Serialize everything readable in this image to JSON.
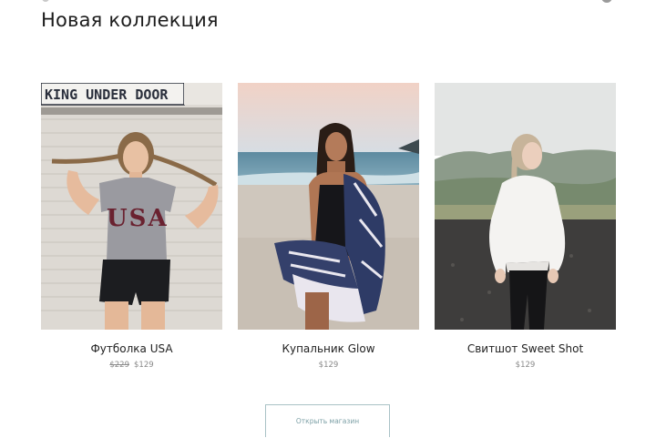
{
  "section": {
    "title": "Новая коллекция"
  },
  "products": [
    {
      "name": "Футболка USA",
      "old_price": "$229",
      "price": "$129",
      "sign_text": "KING UNDER DOOR",
      "shirt_text": "USA"
    },
    {
      "name": "Купальник Glow",
      "old_price": "",
      "price": "$129"
    },
    {
      "name": "Свитшот Sweet Shot",
      "old_price": "",
      "price": "$129"
    }
  ],
  "shop_button": {
    "label": "Открыть магазин"
  },
  "colors": {
    "button_accent": "#7b9fa5",
    "button_border": "#a9c2c6"
  }
}
